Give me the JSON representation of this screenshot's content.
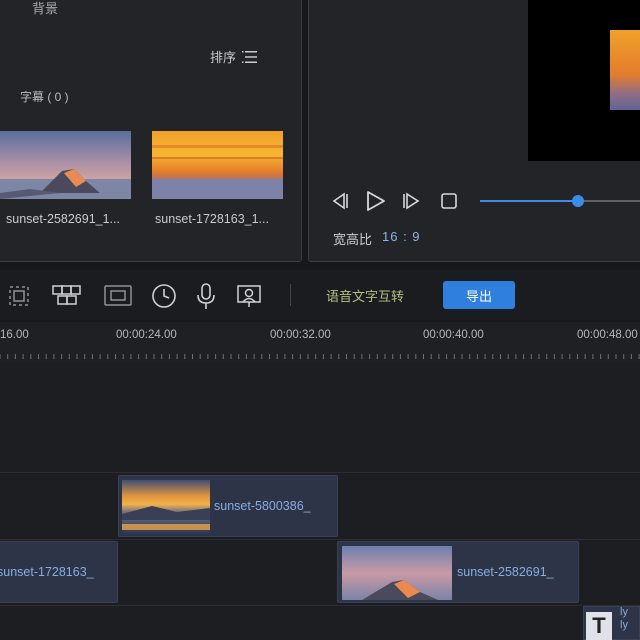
{
  "media_panel": {
    "header_label": "背景",
    "sort_label": "排序",
    "subtitle_label": "字幕 ( 0 )",
    "items": [
      {
        "name": "sunset-2582691_1..."
      },
      {
        "name": "sunset-1728163_1..."
      }
    ]
  },
  "preview": {
    "aspect_label": "宽高比",
    "aspect_value": "16 : 9",
    "progress_fraction": 0.6
  },
  "toolbar": {
    "icons": [
      "crop-icon",
      "split-icon",
      "screen-icon",
      "clock-icon",
      "mic-icon",
      "avatar-icon"
    ],
    "speech_to_text_label": "语音文字互转",
    "export_label": "导出"
  },
  "ruler": {
    "labels": [
      "16.00",
      "00:00:24.00",
      "00:00:32.00",
      "00:00:40.00",
      "00:00:48.00"
    ]
  },
  "timeline": {
    "clips": [
      {
        "label": "sunset-5800386_"
      },
      {
        "label": "sunset-1728163_"
      },
      {
        "label": "sunset-2582691_"
      }
    ],
    "text_clip_glyph": "T",
    "text_clip_dots": "ly\nly"
  },
  "colors": {
    "accent": "#2f7fdf",
    "panel_bg": "#232428",
    "clip_bg": "#2d3448",
    "clip_text": "#86aee0"
  }
}
